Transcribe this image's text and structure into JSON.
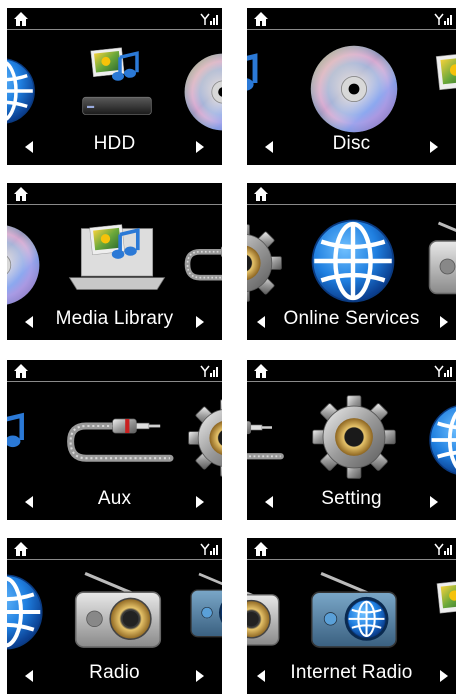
{
  "screens": [
    {
      "label": "HDD"
    },
    {
      "label": "Disc"
    },
    {
      "label": "Media Library"
    },
    {
      "label": "Online Services"
    },
    {
      "label": "Aux"
    },
    {
      "label": "Setting"
    },
    {
      "label": "Radio"
    },
    {
      "label": "Internet Radio"
    }
  ],
  "icons": {
    "home": "home-icon",
    "signal": "signal-strength-icon",
    "left": "left-arrow-icon",
    "right": "right-arrow-icon"
  },
  "colors": {
    "screen_bg": "#000000",
    "text": "#ffffff",
    "globe_blue": "#1f7fe0",
    "gear_gold": "#c99a3a"
  }
}
